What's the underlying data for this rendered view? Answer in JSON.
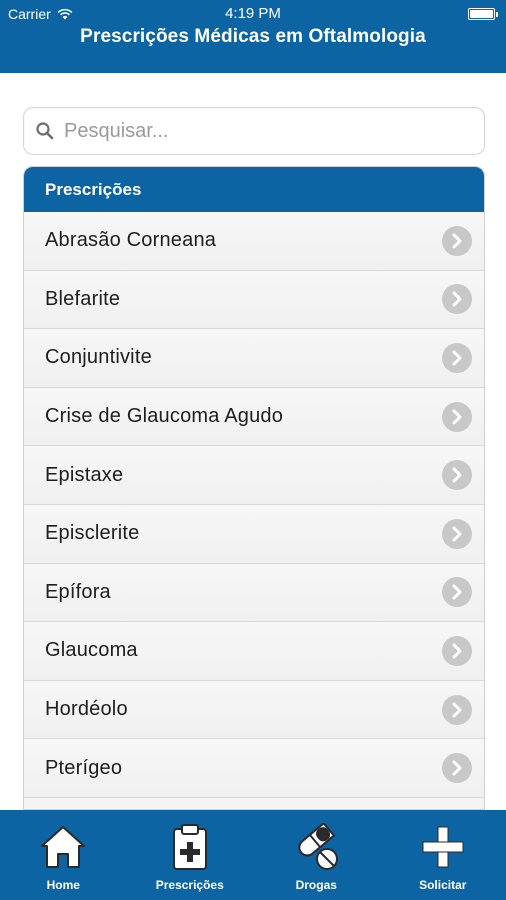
{
  "status_bar": {
    "carrier": "Carrier",
    "time": "4:19 PM"
  },
  "header": {
    "title": "Prescrições Médicas em Oftalmologia"
  },
  "search": {
    "placeholder": "Pesquisar...",
    "value": ""
  },
  "list": {
    "section_title": "Prescrições",
    "items": [
      "Abrasão Corneana",
      "Blefarite",
      "Conjuntivite",
      "Crise de Glaucoma Agudo",
      "Epistaxe",
      "Episclerite",
      "Epífora",
      "Glaucoma",
      "Hordéolo",
      "Pterígeo"
    ]
  },
  "tabbar": {
    "tabs": [
      {
        "label": "Home",
        "icon": "home-icon"
      },
      {
        "label": "Prescrições",
        "icon": "clipboard-plus-icon"
      },
      {
        "label": "Drogas",
        "icon": "pills-icon"
      },
      {
        "label": "Solicitar",
        "icon": "plus-icon"
      }
    ]
  },
  "colors": {
    "brand_blue": "#0d64a3",
    "chevron_gray": "#c8c8c8"
  }
}
